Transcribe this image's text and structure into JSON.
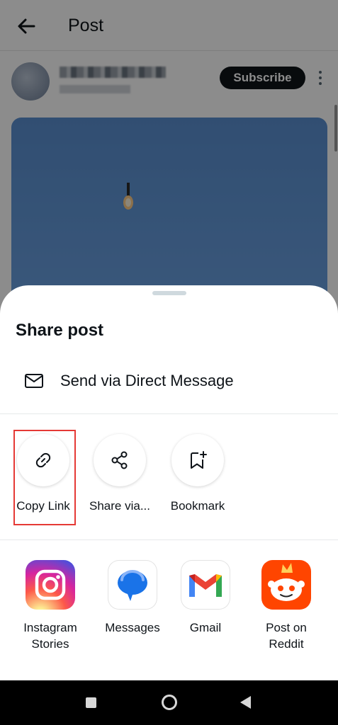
{
  "topbar": {
    "title": "Post"
  },
  "author": {
    "subscribe_label": "Subscribe"
  },
  "sheet": {
    "title": "Share post",
    "dm_label": "Send via Direct Message",
    "actions": [
      {
        "label": "Copy Link",
        "icon": "link-icon"
      },
      {
        "label": "Share via...",
        "icon": "share-icon"
      },
      {
        "label": "Bookmark",
        "icon": "bookmark-add-icon"
      }
    ],
    "apps": [
      {
        "label_line1": "Instagram",
        "label_line2": "Stories",
        "icon": "instagram-icon"
      },
      {
        "label_line1": "Messages",
        "label_line2": "",
        "icon": "messages-icon"
      },
      {
        "label_line1": "Gmail",
        "label_line2": "",
        "icon": "gmail-icon"
      },
      {
        "label_line1": "Post on",
        "label_line2": "Reddit",
        "icon": "reddit-icon"
      }
    ]
  },
  "colors": {
    "accent": "#0f1419",
    "highlight": "#e53935",
    "icon_gray": "#536471"
  }
}
